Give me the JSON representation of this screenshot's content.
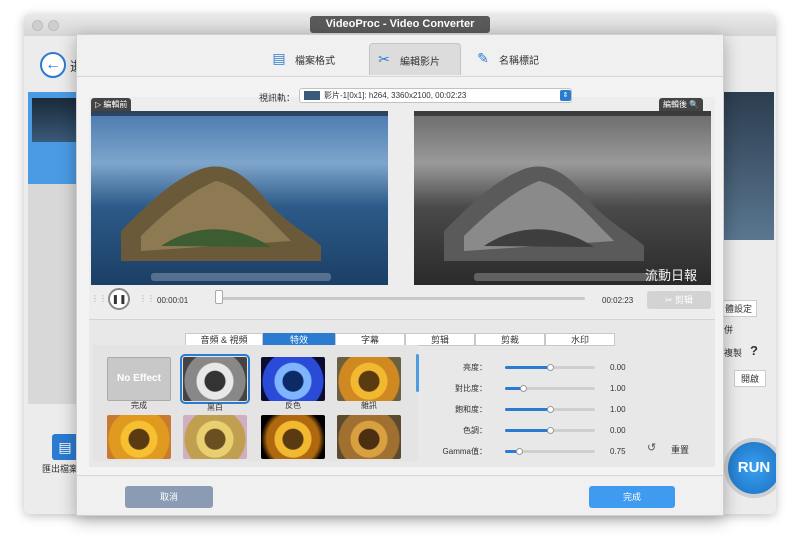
{
  "outer_window": {
    "title": "VideoProc - Video Converter",
    "back_text": "逝",
    "export_label": "匯出檔案格",
    "settings_btn": "體設定",
    "merge_label": "併",
    "copy_label": "複製",
    "help_icon": "?",
    "open_btn": "開啟",
    "run_label": "RUN"
  },
  "modal": {
    "tabs": [
      {
        "label": "檔案格式",
        "icon": "document-icon"
      },
      {
        "label": "編輯影片",
        "icon": "film-cut-icon"
      },
      {
        "label": "名稱標記",
        "icon": "edit-tag-icon"
      }
    ],
    "active_tab": "編輯影片",
    "track": {
      "label": "視訊軌：",
      "value": "影片-1[0x1]: h264, 3360x2100, 00:02:23"
    },
    "preview": {
      "before_label": "編輯前",
      "after_label": "編輯後",
      "watermark": "流動日報"
    },
    "playback": {
      "current_time": "00:00:01",
      "total_time": "00:02:23",
      "progress": 0.01,
      "cut_label": "剪辑"
    },
    "subtabs": [
      "音頻 & 視頻",
      "特效",
      "字幕",
      "剪辑",
      "剪裁",
      "水印"
    ],
    "active_subtab": "特效",
    "effects": [
      {
        "name": "完成",
        "overlay": "No Effect",
        "style": "none"
      },
      {
        "name": "黑白",
        "style": "bw",
        "selected": true
      },
      {
        "name": "反色",
        "style": "invert"
      },
      {
        "name": "雜訊",
        "style": "noise"
      },
      {
        "name": "",
        "style": "warm"
      },
      {
        "name": "",
        "style": "faded"
      },
      {
        "name": "",
        "style": "vignette"
      },
      {
        "name": "",
        "style": "sepia"
      }
    ],
    "adjustments": [
      {
        "label": "亮度：",
        "value": "0.00",
        "level": 0.5
      },
      {
        "label": "對比度：",
        "value": "1.00",
        "level": 0.2
      },
      {
        "label": "飽和度：",
        "value": "1.00",
        "level": 0.5
      },
      {
        "label": "色調：",
        "value": "0.00",
        "level": 0.5
      },
      {
        "label": "Gamma值：",
        "value": "0.75",
        "level": 0.15
      }
    ],
    "reset_label": "重置",
    "cancel_label": "取消",
    "done_label": "完成"
  }
}
